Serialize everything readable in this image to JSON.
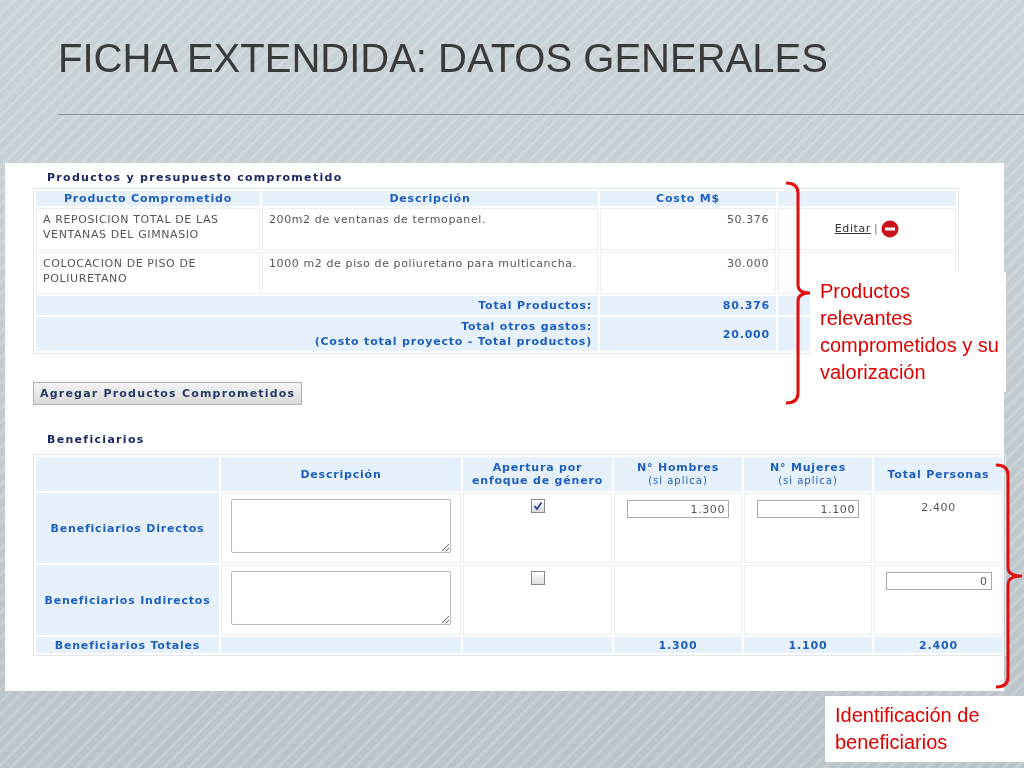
{
  "slide": {
    "title": "FICHA EXTENDIDA: DATOS GENERALES"
  },
  "products": {
    "heading": "Productos y presupuesto comprometido",
    "columns": [
      "Producto Comprometido",
      "Descripción",
      "Costo M$"
    ],
    "rows": [
      {
        "product": "A REPOSICION TOTAL DE LAS VENTANAS DEL GIMNASIO",
        "description": "200m2 de ventanas de termopanel.",
        "cost": "50.376",
        "action": {
          "link": "Editar",
          "separator": "|"
        }
      },
      {
        "product": "COLOCACION DE PISO DE POLIURETANO",
        "description": "1000 m2 de piso de poliuretano para multicancha.",
        "cost": "30.000"
      }
    ],
    "totals": [
      {
        "lines": [
          "Total Productos:"
        ],
        "value": "80.376"
      },
      {
        "lines": [
          "Total otros gastos:",
          "(Costo total proyecto - Total productos)"
        ],
        "value": "20.000"
      }
    ],
    "add_button": "Agregar Productos Comprometidos"
  },
  "beneficiaries": {
    "heading": "Beneficiarios",
    "columns": [
      {
        "title": "Descripción"
      },
      {
        "title": "Apertura por enfoque de género"
      },
      {
        "title": "N° Hombres",
        "subtitle": "(si aplica)"
      },
      {
        "title": "N° Mujeres",
        "subtitle": "(si aplica)"
      },
      {
        "title": "Total Personas"
      }
    ],
    "rows": [
      {
        "label": "Beneficiarios Directos",
        "gender_focus": true,
        "men": {
          "kind": "field",
          "value": "1.300"
        },
        "women": {
          "kind": "field",
          "value": "1.100"
        },
        "total": {
          "kind": "text",
          "value": "2.400"
        }
      },
      {
        "label": "Beneficiarios Indirectos",
        "gender_focus": false,
        "total": {
          "kind": "field",
          "value": "0"
        }
      }
    ],
    "totals": {
      "label": "Beneficiarios Totales",
      "men": "1.300",
      "women": "1.100",
      "total": "2.400"
    }
  },
  "callouts": [
    {
      "text": "Productos relevantes comprometidos y su valorización"
    },
    {
      "text": "Identificación de beneficiarios"
    }
  ]
}
